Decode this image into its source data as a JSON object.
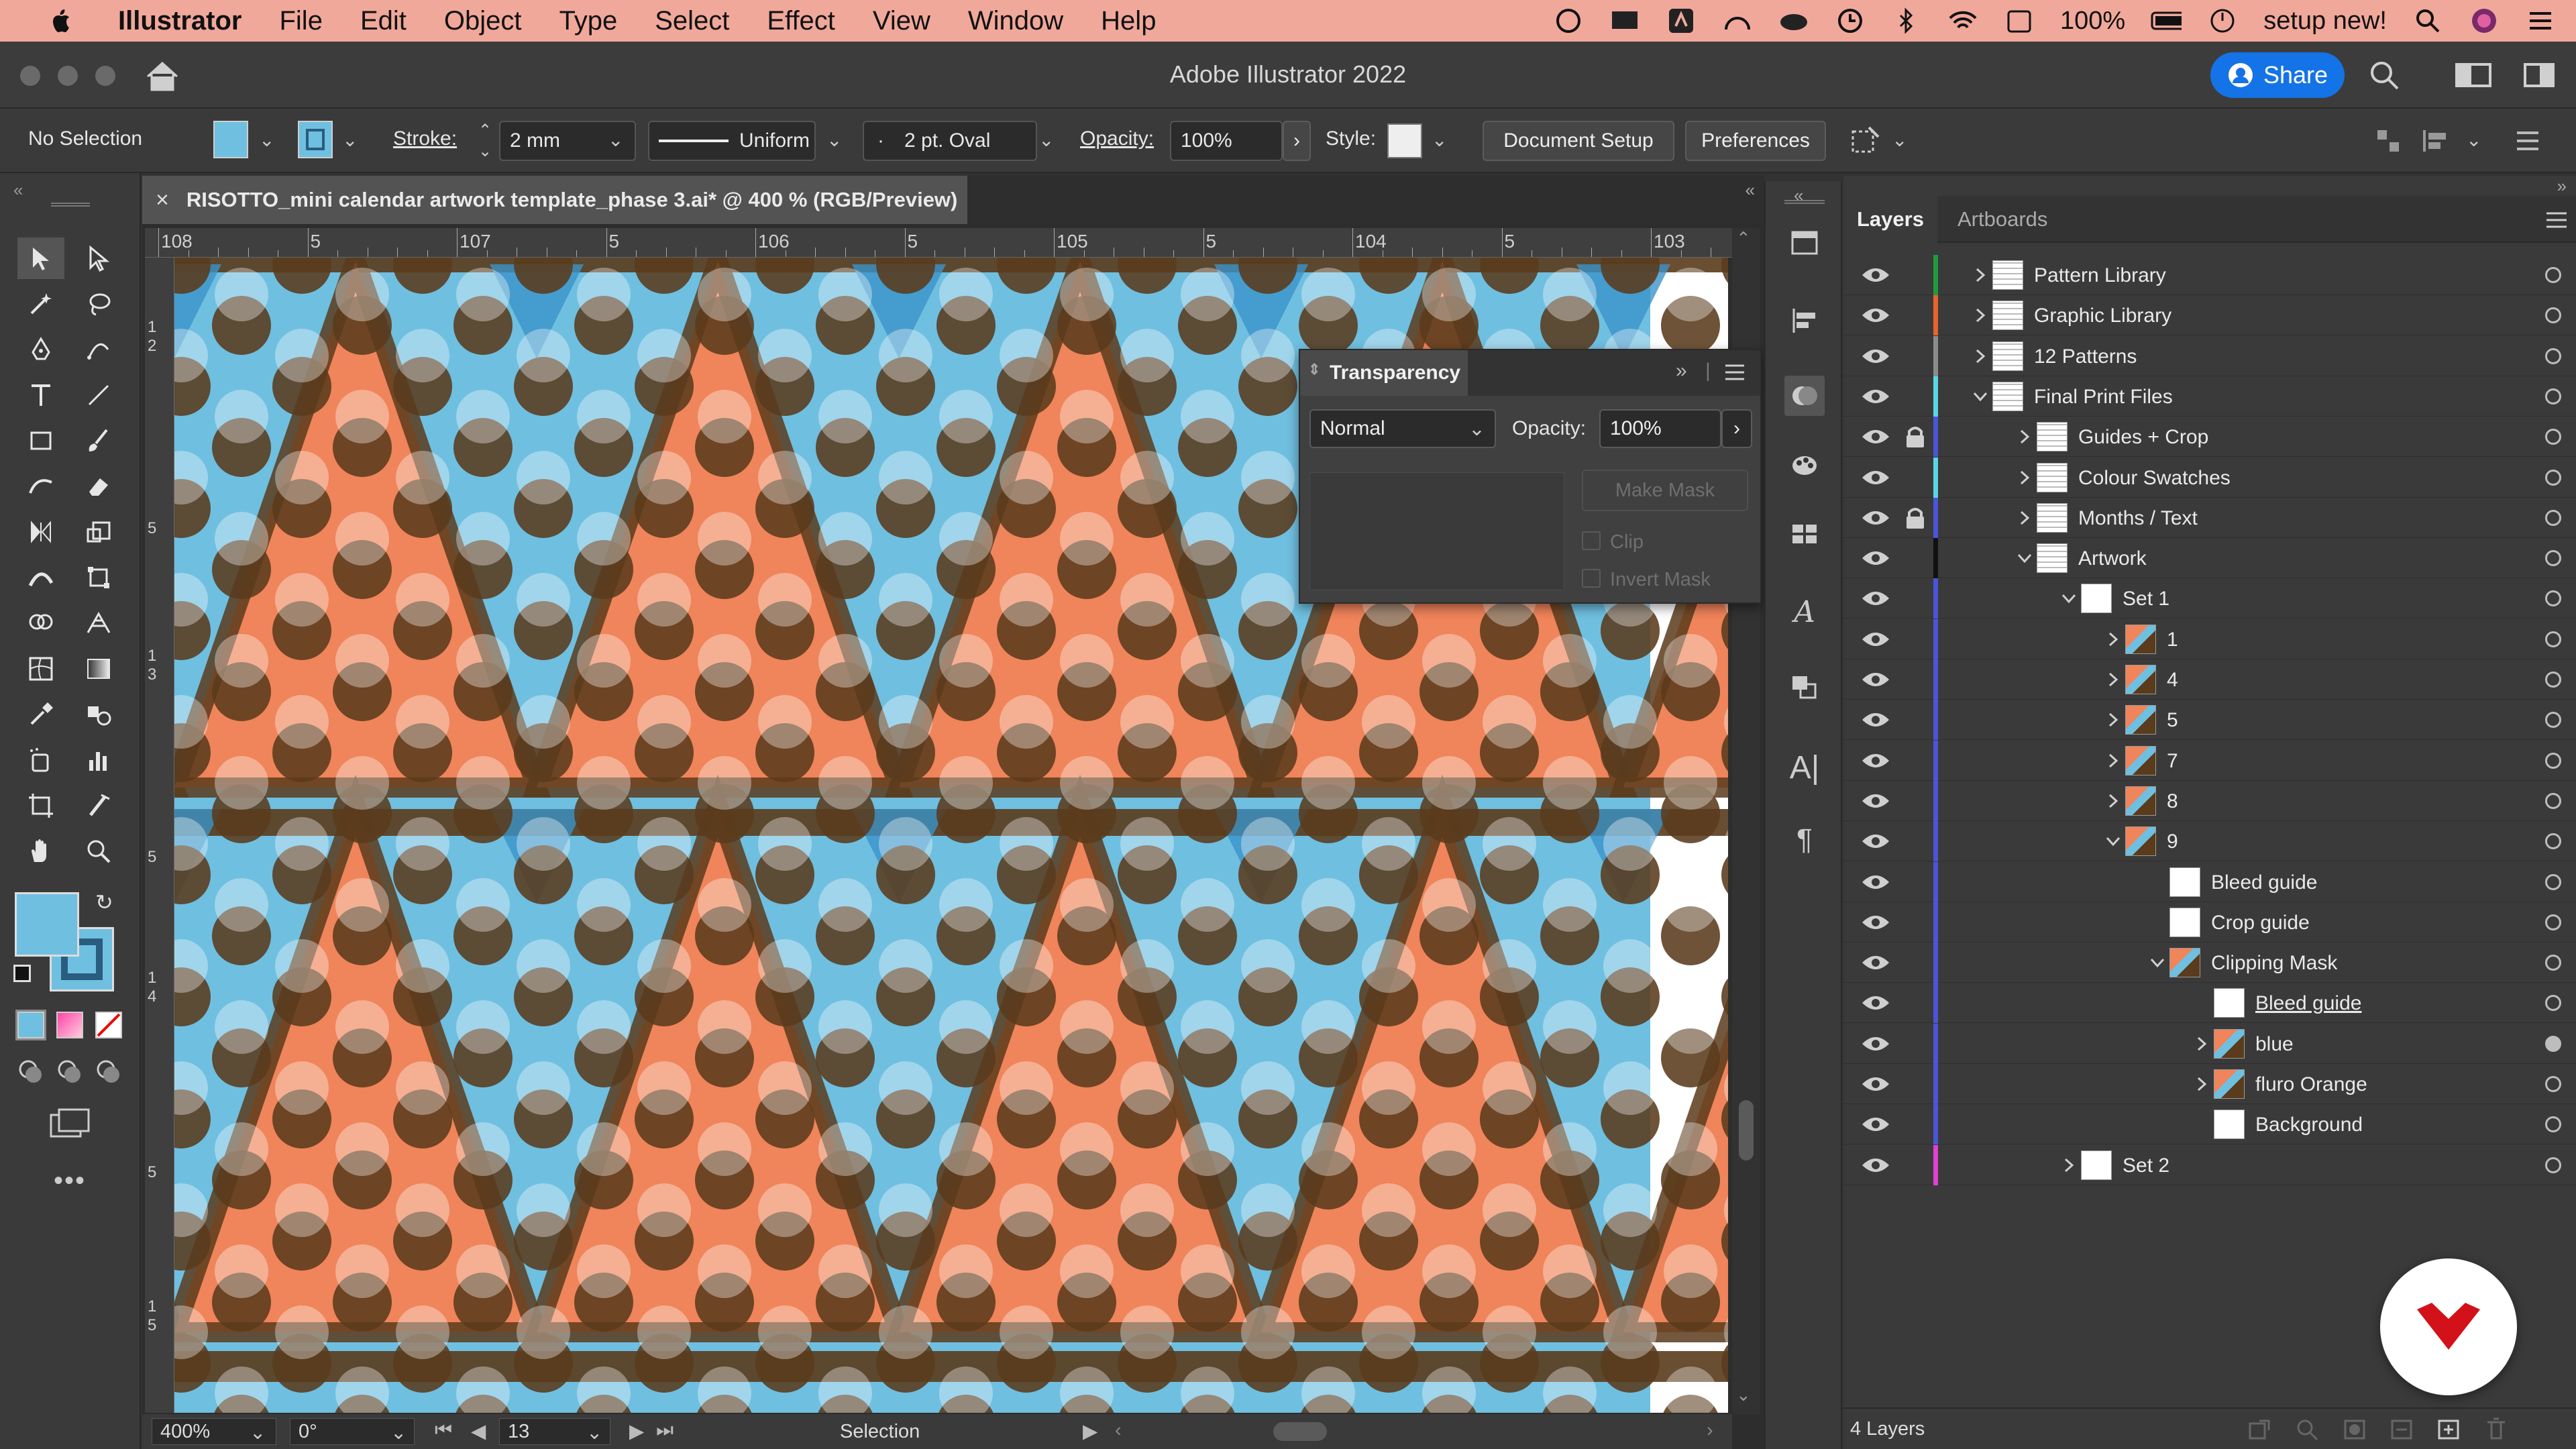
{
  "menubar": {
    "app": "Illustrator",
    "items": [
      "File",
      "Edit",
      "Object",
      "Type",
      "Select",
      "Effect",
      "View",
      "Window",
      "Help"
    ],
    "battery": "100%",
    "user": "setup new!"
  },
  "titlebar": {
    "title": "Adobe Illustrator 2022",
    "share_label": "Share"
  },
  "control": {
    "selection": "No Selection",
    "stroke_label": "Stroke:",
    "stroke_value": "2 mm",
    "profile": "Uniform",
    "brush": "2 pt. Oval",
    "opacity_label": "Opacity:",
    "opacity_value": "100%",
    "style_label": "Style:",
    "document_setup": "Document Setup",
    "preferences": "Preferences"
  },
  "document": {
    "tab_title": "RISOTTO_mini calendar artwork template_phase 3.ai* @ 400 % (RGB/Preview)",
    "ruler_labels": [
      "108",
      "5",
      "107",
      "5",
      "106",
      "5",
      "105",
      "5",
      "104",
      "5",
      "103"
    ],
    "vruler_labels": [
      "1 2",
      "5",
      "1 3",
      "5",
      "1 4",
      "5",
      "1 5"
    ]
  },
  "status": {
    "zoom": "400%",
    "rotation": "0°",
    "artboard": "13",
    "tool": "Selection"
  },
  "transparency": {
    "title": "Transparency",
    "blend_mode": "Normal",
    "opacity_label": "Opacity:",
    "opacity_value": "100%",
    "make_mask": "Make Mask",
    "clip": "Clip",
    "invert_mask": "Invert Mask"
  },
  "layers": {
    "tabs": [
      "Layers",
      "Artboards"
    ],
    "footer": "4 Layers",
    "rows": [
      {
        "name": "Pattern Library",
        "level": 0,
        "color": "#1e9b3d",
        "lock": false,
        "disclose": "closed"
      },
      {
        "name": "Graphic Library",
        "level": 0,
        "color": "#e8642c",
        "lock": false,
        "disclose": "closed"
      },
      {
        "name": "12 Patterns",
        "level": 0,
        "color": "#8c8c8c",
        "lock": false,
        "disclose": "closed"
      },
      {
        "name": "Final Print Files",
        "level": 0,
        "color": "#59d6e6",
        "lock": false,
        "disclose": "open"
      },
      {
        "name": "Guides + Crop",
        "level": 1,
        "color": "#4a55d9",
        "lock": true,
        "disclose": "closed"
      },
      {
        "name": "Colour Swatches",
        "level": 1,
        "color": "#59d6e6",
        "lock": false,
        "disclose": "closed"
      },
      {
        "name": "Months / Text",
        "level": 1,
        "color": "#4a55d9",
        "lock": true,
        "disclose": "closed"
      },
      {
        "name": "Artwork",
        "level": 1,
        "color": "#111111",
        "lock": false,
        "disclose": "open"
      },
      {
        "name": "Set 1",
        "level": 2,
        "color": "#4a55d9",
        "lock": false,
        "disclose": "open"
      },
      {
        "name": "1",
        "level": 3,
        "color": "#4a55d9",
        "lock": false,
        "disclose": "closed"
      },
      {
        "name": "4",
        "level": 3,
        "color": "#4a55d9",
        "lock": false,
        "disclose": "closed"
      },
      {
        "name": "5",
        "level": 3,
        "color": "#4a55d9",
        "lock": false,
        "disclose": "closed"
      },
      {
        "name": "7",
        "level": 3,
        "color": "#4a55d9",
        "lock": false,
        "disclose": "closed"
      },
      {
        "name": "8",
        "level": 3,
        "color": "#4a55d9",
        "lock": false,
        "disclose": "closed"
      },
      {
        "name": "9",
        "level": 3,
        "color": "#4a55d9",
        "lock": false,
        "disclose": "open"
      },
      {
        "name": "Bleed guide",
        "level": 4,
        "color": "#4a55d9",
        "lock": false,
        "disclose": "none"
      },
      {
        "name": "Crop guide",
        "level": 4,
        "color": "#4a55d9",
        "lock": false,
        "disclose": "none"
      },
      {
        "name": "Clipping Mask",
        "level": 4,
        "color": "#4a55d9",
        "lock": false,
        "disclose": "open"
      },
      {
        "name": "Bleed guide",
        "level": 5,
        "color": "#4a55d9",
        "lock": false,
        "disclose": "none"
      },
      {
        "name": "blue",
        "level": 5,
        "color": "#4a55d9",
        "lock": false,
        "disclose": "closed"
      },
      {
        "name": "fluro Orange",
        "level": 5,
        "color": "#4a55d9",
        "lock": false,
        "disclose": "closed"
      },
      {
        "name": "Background",
        "level": 5,
        "color": "#4a55d9",
        "lock": false,
        "disclose": "none"
      },
      {
        "name": "Set 2",
        "level": 2,
        "color": "#e040d0",
        "lock": false,
        "disclose": "closed"
      }
    ]
  },
  "colors": {
    "canvas_blue": "#6fbfe0",
    "orange": "#f0845a",
    "brown": "#5a3b1c",
    "accent": "#1473e6"
  }
}
